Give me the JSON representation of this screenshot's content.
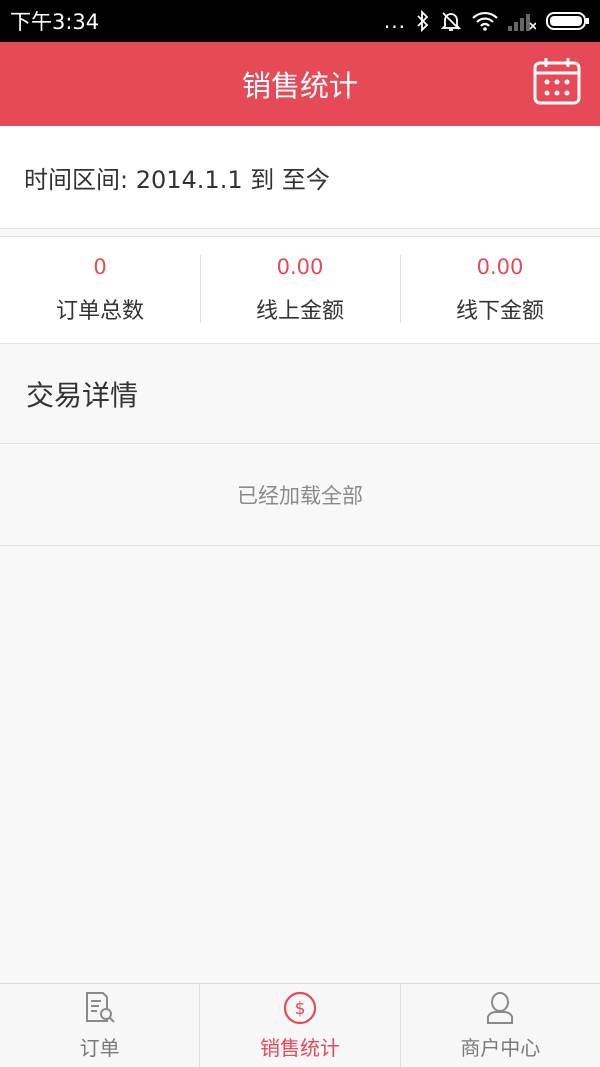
{
  "status_bar": {
    "time": "下午3:34",
    "dots": "..."
  },
  "header": {
    "title": "销售统计",
    "calendar_icon": "calendar-icon"
  },
  "time_range": {
    "text": "时间区间: 2014.1.1 到 至今"
  },
  "stats": [
    {
      "value": "0",
      "label": "订单总数"
    },
    {
      "value": "0.00",
      "label": "线上金额"
    },
    {
      "value": "0.00",
      "label": "线下金额"
    }
  ],
  "details": {
    "title": "交易详情",
    "loaded_all": "已经加载全部"
  },
  "tabs": [
    {
      "label": "订单",
      "icon": "order-icon",
      "active": false
    },
    {
      "label": "销售统计",
      "icon": "dollar-icon",
      "active": true
    },
    {
      "label": "商户中心",
      "icon": "user-icon",
      "active": false
    }
  ],
  "colors": {
    "accent": "#e64a56",
    "status_bar": "#000000",
    "background": "#f8f8f8"
  }
}
